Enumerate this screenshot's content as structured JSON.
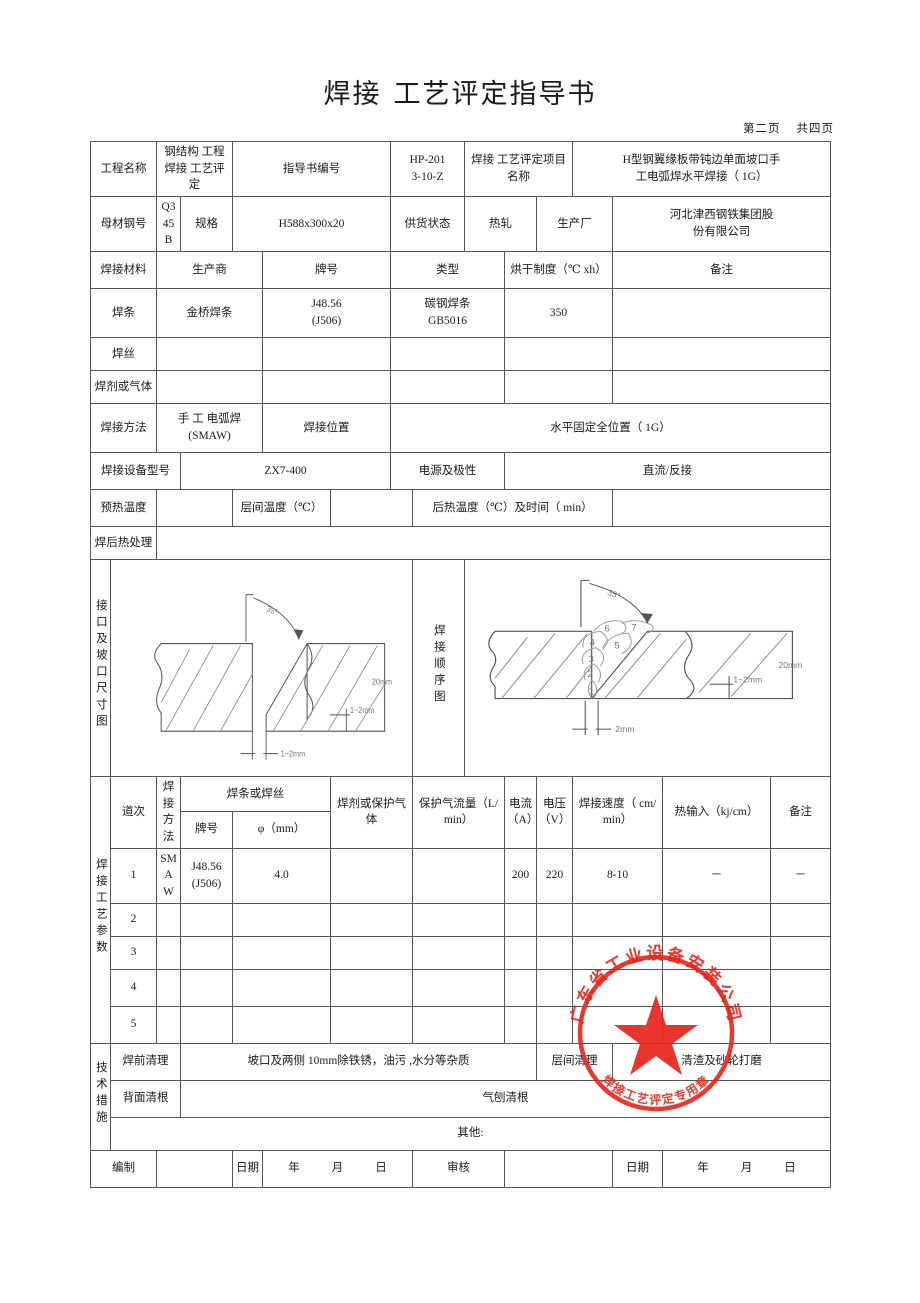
{
  "document": {
    "title_part1": "焊接",
    "title_part2": "工艺评定指导书",
    "page_number": "第二页",
    "page_total": "共四页"
  },
  "header_row": {
    "project_name_label": "工程名称",
    "project_name_value": "钢结构 工程焊接 工艺评定",
    "instruction_no_label": "指导书编号",
    "instruction_no_value_line1": "HP-201",
    "instruction_no_value_line2": "3-10-Z",
    "project_item_label": "焊接 工艺评定项目名称",
    "project_item_value_line1": "H型钢翼缘板带钝边单面坡口手",
    "project_item_value_line2": "工电弧焊水平焊接（   1G）"
  },
  "base_metal": {
    "grade_label": "母材钢号",
    "grade_value": "Q345B",
    "spec_label": "规格",
    "spec_value": "H588x300x20",
    "supply_state_label": "供货状态",
    "supply_state_value": "热轧",
    "manufacturer_label": "生产厂",
    "manufacturer_value_line1": "河北津西钢铁集团股",
    "manufacturer_value_line2": "份有限公司"
  },
  "consumables": {
    "section_label": "焊接材料",
    "col_producer": "生产商",
    "col_brand": "牌号",
    "col_type": "类型",
    "col_baking": "烘干制度（℃ xh）",
    "col_remark": "备注",
    "rows": [
      {
        "name": "焊条",
        "producer": "金桥焊条",
        "brand_line1": "J48.56",
        "brand_line2": "(J506)",
        "type_line1": "碳钢焊条",
        "type_line2": "GB5016",
        "baking": "350",
        "remark": ""
      },
      {
        "name": "焊丝",
        "producer": "",
        "brand_line1": "",
        "brand_line2": "",
        "type_line1": "",
        "type_line2": "",
        "baking": "",
        "remark": ""
      },
      {
        "name": "焊剂或气体",
        "producer": "",
        "brand_line1": "",
        "brand_line2": "",
        "type_line1": "",
        "type_line2": "",
        "baking": "",
        "remark": ""
      }
    ]
  },
  "process": {
    "method_label": "焊接方法",
    "method_value_line1": "手 工 电弧焊",
    "method_value_line2": "(SMAW)",
    "position_label": "焊接位置",
    "position_value": "水平固定全位置（   1G）",
    "equipment_label": "焊接设备型号",
    "equipment_value": "ZX7-400",
    "polarity_label": "电源及极性",
    "polarity_value": "直流/反接",
    "preheat_label": "预热温度",
    "preheat_value": "",
    "interpass_label": "层间温度（℃）",
    "interpass_value": "",
    "postheat_label": "后热温度（℃）及时间（   min）",
    "postheat_value": "",
    "pwht_label": "焊后热处理",
    "pwht_value": ""
  },
  "diagrams": {
    "joint_label": "接口及坡口尺寸图",
    "sequence_label": "焊接顺序图",
    "joint_angle": "35°",
    "joint_gap": "1~2mm",
    "joint_root_face": "1~2mm",
    "joint_thickness": "20mm",
    "seq_angle": "35°",
    "seq_gap": "2mm",
    "seq_root_face": "1~2mm",
    "seq_thickness": "20mm",
    "seq_passes": [
      "1",
      "2",
      "3",
      "4",
      "5",
      "6",
      "7"
    ]
  },
  "parameters": {
    "section_label": "焊接工艺参数",
    "col_pass": "道次",
    "col_method": "焊接方法",
    "col_group_electrode": "焊条或焊丝",
    "col_brand": "牌号",
    "col_diameter": "φ（mm）",
    "col_flux_gas": "焊剂或保护气体",
    "col_gas_flow": "保护气流量（L/min）",
    "col_current": "电流（A）",
    "col_voltage": "电压（V）",
    "col_speed": "焊接速度（ cm/min）",
    "col_heat_input": "热输入（kj/cm）",
    "col_remark": "备注",
    "rows": [
      {
        "pass": "1",
        "method_line1": "SMA",
        "method_line2": "W",
        "brand_line1": "J48.56",
        "brand_line2": "(J506)",
        "diameter": "4.0",
        "flux_gas": "",
        "gas_flow": "",
        "current": "200",
        "voltage": "220",
        "speed": "8-10",
        "heat_input": "－",
        "remark": "－"
      },
      {
        "pass": "2",
        "method_line1": "",
        "method_line2": "",
        "brand_line1": "",
        "brand_line2": "",
        "diameter": "",
        "flux_gas": "",
        "gas_flow": "",
        "current": "",
        "voltage": "",
        "speed": "",
        "heat_input": "",
        "remark": ""
      },
      {
        "pass": "3",
        "method_line1": "",
        "method_line2": "",
        "brand_line1": "",
        "brand_line2": "",
        "diameter": "",
        "flux_gas": "",
        "gas_flow": "",
        "current": "",
        "voltage": "",
        "speed": "",
        "heat_input": "",
        "remark": ""
      },
      {
        "pass": "4",
        "method_line1": "",
        "method_line2": "",
        "brand_line1": "",
        "brand_line2": "",
        "diameter": "",
        "flux_gas": "",
        "gas_flow": "",
        "current": "",
        "voltage": "",
        "speed": "",
        "heat_input": "",
        "remark": ""
      },
      {
        "pass": "5",
        "method_line1": "",
        "method_line2": "",
        "brand_line1": "",
        "brand_line2": "",
        "diameter": "",
        "flux_gas": "",
        "gas_flow": "",
        "current": "",
        "voltage": "",
        "speed": "",
        "heat_input": "",
        "remark": ""
      }
    ]
  },
  "technical_measures": {
    "section_label": "技术措施",
    "preclean_label": "焊前清理",
    "preclean_value": "坡口及两侧  10mm除铁锈，油污  ,水分等杂质",
    "interpass_clean_label": "层间清理",
    "interpass_clean_value": "清渣及砂轮打磨",
    "backgouge_label": "背面清根",
    "backgouge_value": "气刨清根",
    "other_label": "其他:",
    "other_value": ""
  },
  "signoff": {
    "prepared_label": "编制",
    "prepared_value": "",
    "prepared_date_label": "日期",
    "prepared_date_y": "年",
    "prepared_date_m": "月",
    "prepared_date_d": "日",
    "reviewed_label": "审核",
    "reviewed_value": "",
    "reviewed_date_label": "日期",
    "reviewed_date_y": "年",
    "reviewed_date_m": "月",
    "reviewed_date_d": "日"
  },
  "stamp": {
    "top_text": "广东省工业设备安装公司",
    "bottom_text": "焊接工艺评定专用章",
    "color": "#e8241c"
  }
}
